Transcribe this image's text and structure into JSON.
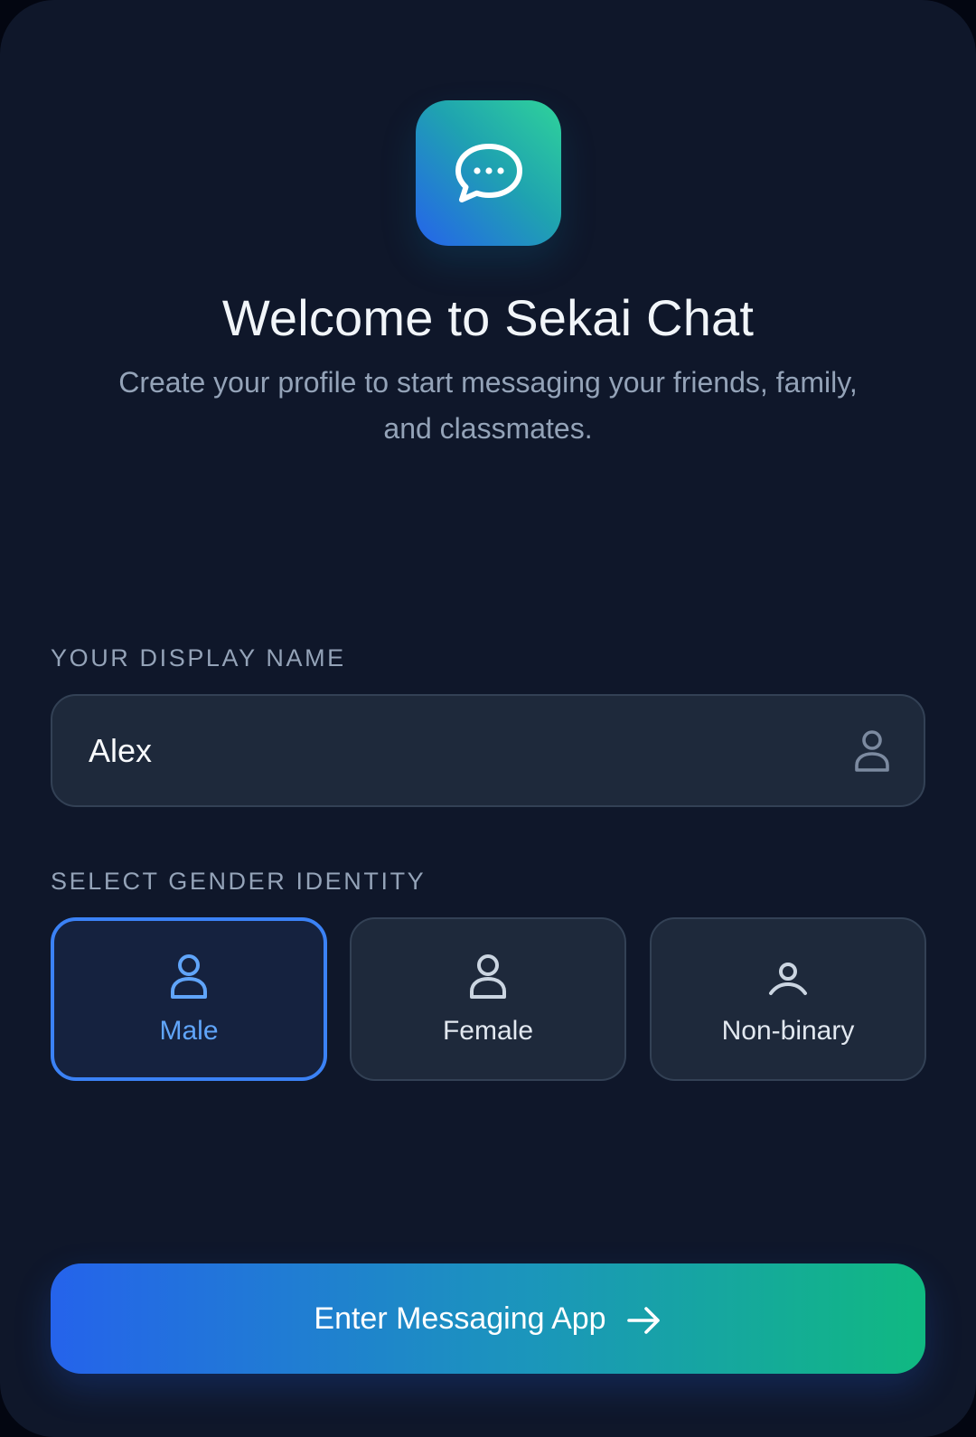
{
  "colors": {
    "background": "#0f172a",
    "surface": "#1e293b",
    "accent": "#3b82f6",
    "accent_text": "#60a5fa",
    "gradient_start": "#2563eb",
    "gradient_end": "#10b981"
  },
  "header": {
    "app_icon": "chat-bubble-icon",
    "title": "Welcome to Sekai Chat",
    "subtitle": "Create your profile to start messaging your friends, family, and classmates."
  },
  "display_name": {
    "label": "YOUR DISPLAY NAME",
    "value": "Alex",
    "icon": "user-icon"
  },
  "gender": {
    "label": "SELECT GENDER IDENTITY",
    "selected": "Male",
    "options": [
      {
        "label": "Male",
        "icon": "user-icon"
      },
      {
        "label": "Female",
        "icon": "user-icon"
      },
      {
        "label": "Non-binary",
        "icon": "user-small-icon"
      }
    ]
  },
  "submit": {
    "label": "Enter Messaging App",
    "icon": "arrow-right-icon"
  }
}
